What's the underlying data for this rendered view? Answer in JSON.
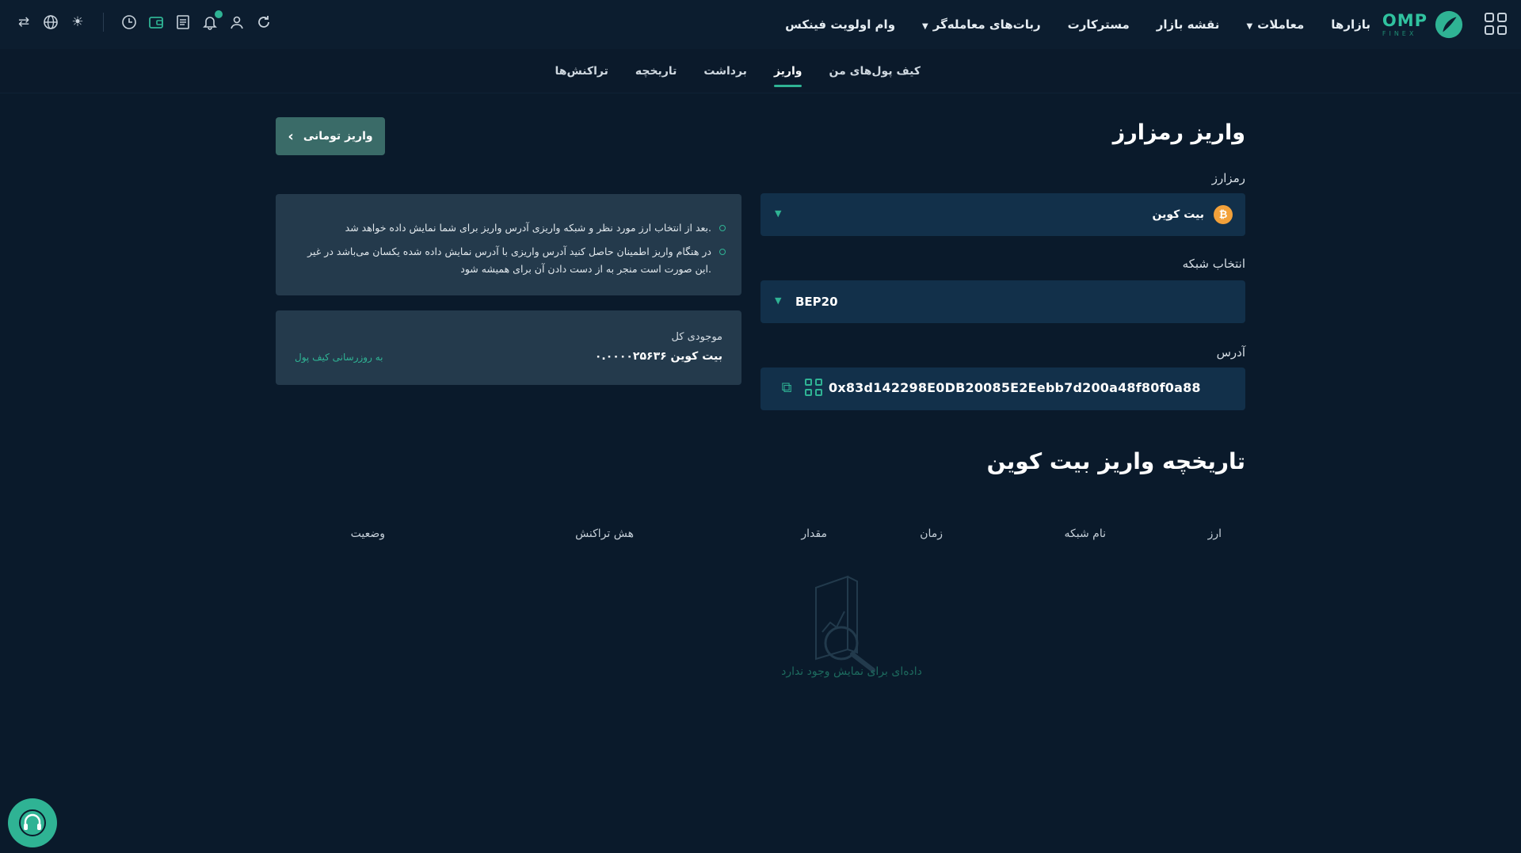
{
  "header": {
    "nav": [
      {
        "label": "بازارها",
        "caret": false
      },
      {
        "label": "معاملات",
        "caret": true
      },
      {
        "label": "نقشه بازار",
        "caret": false
      },
      {
        "label": "مسترکارت",
        "caret": false
      },
      {
        "label": "ربات‌های معامله‌گر",
        "caret": true
      },
      {
        "label": "وام اولویت فینکس",
        "caret": false
      }
    ],
    "logo": {
      "name": "OMP",
      "sub": "FINEX"
    }
  },
  "tabs": [
    {
      "label": "کیف پول‌های من",
      "active": false
    },
    {
      "label": "واریز",
      "active": true
    },
    {
      "label": "برداشت",
      "active": false
    },
    {
      "label": "تاریخچه",
      "active": false
    },
    {
      "label": "تراکنش‌ها",
      "active": false
    }
  ],
  "deposit": {
    "title": "واریز رمزارز",
    "toman_button": "واریز تومانی",
    "coin_label": "رمزارز",
    "coin_value": "بیت کوین",
    "coin_symbol": "₿",
    "network_label": "انتخاب شبکه",
    "network_value": "BEP20",
    "address_label": "آدرس",
    "address_value": "0x83d142298E0DB20085E2Eebb7d200a48f80f0a88"
  },
  "info": {
    "line1": "بعد از انتخاب ارز مورد نظر و شبکه واریزی آدرس واریز برای شما نمایش داده خواهد شد.",
    "line2": "در هنگام واریز اطمینان حاصل کنید آدرس واریزی با آدرس نمایش داده شده یکسان می‌باشد در غیر این صورت است منجر به از دست دادن آن برای همیشه شود."
  },
  "balance": {
    "label": "موجودی کل",
    "value": "۰.۰۰۰۰۲۵۶۳۶ بیت کوین",
    "link": "به روزرسانی کیف پول"
  },
  "history": {
    "title": "تاریخچه واریز بیت کوین",
    "columns": [
      "ارز",
      "نام شبکه",
      "زمان",
      "مقدار",
      "هش تراکنش",
      "وضعیت"
    ],
    "empty": "داده‌ای برای نمایش وجود ندارد"
  },
  "colors": {
    "accent": "#2fb394",
    "background": "#0a1a2b",
    "panel": "#243a4c",
    "select": "#12304a"
  }
}
